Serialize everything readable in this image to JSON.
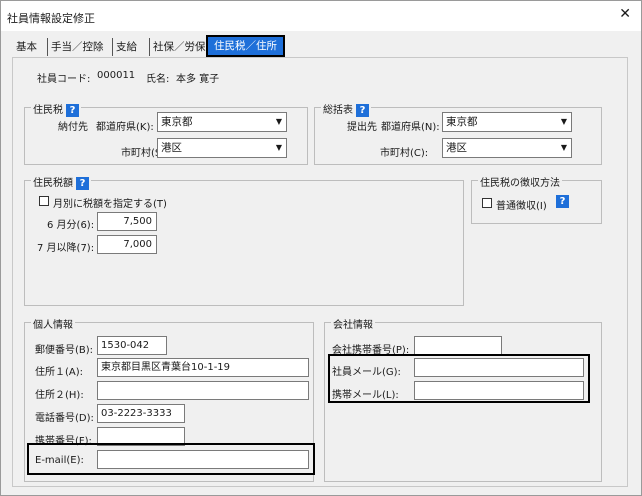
{
  "window": {
    "title": "社員情報設定修正",
    "close_glyph": "✕"
  },
  "tabs": [
    {
      "label": "基本"
    },
    {
      "label": "手当／控除"
    },
    {
      "label": "支給"
    },
    {
      "label": "社保／労保"
    },
    {
      "label": "住民税／住所"
    }
  ],
  "employee": {
    "code_label": "社員コード:",
    "code": "000011",
    "name_label": "氏名:",
    "name": "本多  寛子"
  },
  "resident_tax": {
    "title": "住民税",
    "help": "?",
    "payee_label": "納付先",
    "prefecture_label": "都道府県(K):",
    "prefecture_value": "東京都",
    "city_label": "市町村(S):",
    "city_value": "港区"
  },
  "summary_table": {
    "title": "総括表",
    "help": "?",
    "submit_label": "提出先",
    "prefecture_label": "都道府県(N):",
    "prefecture_value": "東京都",
    "city_label": "市町村(C):",
    "city_value": "港区"
  },
  "tax_amount": {
    "title": "住民税額",
    "help": "?",
    "monthly_check_label": "月別に税額を指定する(T)",
    "june_label": "6 月分(6):",
    "june_value": "7,500",
    "july_label": "7 月以降(7):",
    "july_value": "7,000"
  },
  "collection": {
    "title": "住民税の徴収方法",
    "ordinary_label": "普通徴収(I)",
    "help": "?"
  },
  "personal": {
    "title": "個人情報",
    "postal_label": "郵便番号(B):",
    "postal_value": "1530-042",
    "address1_label": "住所１(A):",
    "address1_value": "東京都目黒区青葉台10-1-19",
    "address2_label": "住所２(H):",
    "address2_value": "",
    "phone_label": "電話番号(D):",
    "phone_value": "03-2223-3333",
    "mobile_label": "携帯番号(F):",
    "mobile_value": "",
    "email_label": "E-mail(E):",
    "email_value": ""
  },
  "company": {
    "title": "会社情報",
    "mobile_label": "会社携帯番号(P):",
    "mobile_value": "",
    "email_label": "社員メール(G):",
    "email_value": "",
    "mobile_mail_label": "携帯メール(L):",
    "mobile_mail_value": ""
  },
  "colors": {
    "accent": "#1e6fd9",
    "highlight": "#000000",
    "panel": "#f0f0f0"
  }
}
